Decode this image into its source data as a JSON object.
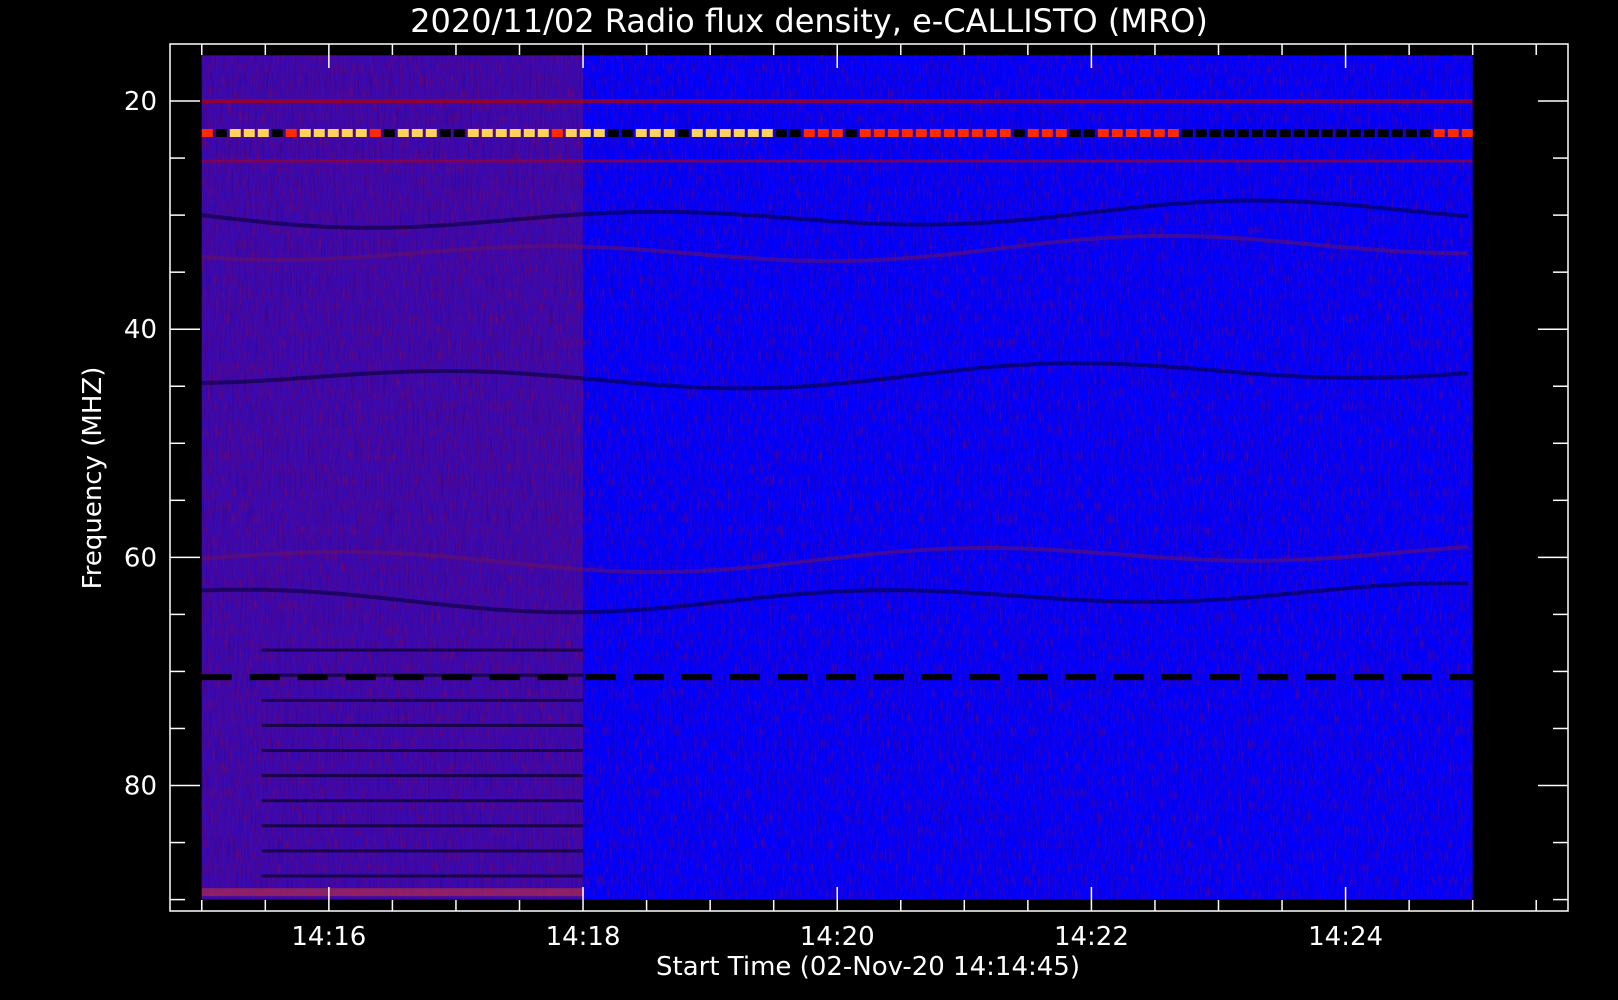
{
  "chart_data": {
    "type": "heatmap",
    "title": "2020/11/02  Radio flux density, e-CALLISTO (MRO)",
    "xlabel": "Start Time (02-Nov-20 14:14:45)",
    "ylabel": "Frequency (MHZ)",
    "x_range": [
      "14:14:45",
      "14:25:45"
    ],
    "ylim": [
      91,
      15
    ],
    "x_ticks": [
      "14:16",
      "14:18",
      "14:20",
      "14:22",
      "14:24"
    ],
    "x_tick_minutes": [
      16,
      18,
      20,
      22,
      24
    ],
    "x_minor_minutes": [
      15.0,
      15.5,
      16.5,
      17.0,
      17.5,
      18.5,
      19.0,
      19.5,
      20.5,
      21.0,
      21.5,
      22.5,
      23.0,
      23.5,
      24.5,
      25.0,
      25.5
    ],
    "y_ticks": [
      "20",
      "40",
      "60",
      "80"
    ],
    "y_tick_values": [
      20,
      40,
      60,
      80
    ],
    "y_minor_values": [
      25,
      30,
      35,
      45,
      50,
      55,
      65,
      70,
      75,
      85,
      90
    ],
    "data_extent": {
      "time_start_min": 15.0,
      "time_end_min": 25.0,
      "freq_min": 16,
      "freq_max": 90
    },
    "colormap": [
      "#000000",
      "#0000ff",
      "#b00000",
      "#ff3000",
      "#ffff80"
    ],
    "features": {
      "strong_bands_mhz": [
        20,
        22.8,
        25.3
      ],
      "dark_band_mhz": [
        70.5
      ],
      "segment_change_min": 18.0
    },
    "grid": false,
    "legend": "none"
  }
}
